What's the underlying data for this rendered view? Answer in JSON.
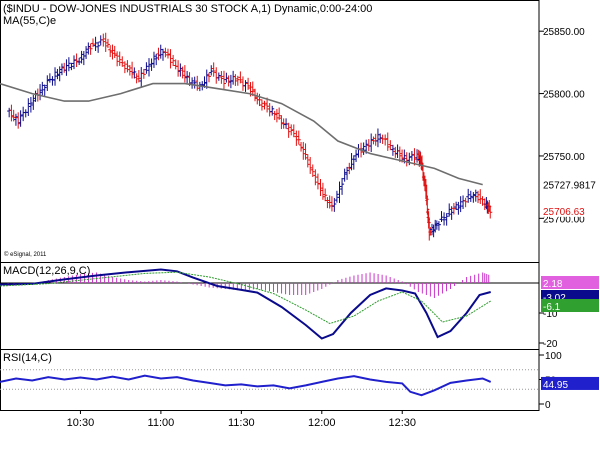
{
  "chart_data": [
    {
      "type": "candlestick",
      "title": "($INDU - DOW-JONES INDUSTRIALS 30 STOCK A,1) Dynamic,0:00-24:00",
      "overlay_label": "MA(55,C)e",
      "watermark": "© eSignal, 2011",
      "ylim": [
        25665,
        25875
      ],
      "y_ticks": [
        "25850.00",
        "25800.00",
        "25750.00",
        "25700.00"
      ],
      "x_ticks": [
        "10:30",
        "11:00",
        "11:30",
        "12:00",
        "12:30"
      ],
      "ma_value_label": "25727.9817",
      "price_value_label": "25706.63",
      "close_points": [
        [
          10.05,
          25786
        ],
        [
          10.12,
          25778
        ],
        [
          10.2,
          25793
        ],
        [
          10.27,
          25805
        ],
        [
          10.35,
          25815
        ],
        [
          10.42,
          25822
        ],
        [
          10.5,
          25827
        ],
        [
          10.57,
          25838
        ],
        [
          10.65,
          25842
        ],
        [
          10.72,
          25830
        ],
        [
          10.8,
          25820
        ],
        [
          10.87,
          25812
        ],
        [
          10.95,
          25826
        ],
        [
          11.02,
          25835
        ],
        [
          11.1,
          25822
        ],
        [
          11.17,
          25812
        ],
        [
          11.25,
          25805
        ],
        [
          11.32,
          25818
        ],
        [
          11.4,
          25810
        ],
        [
          11.47,
          25812
        ],
        [
          11.55,
          25806
        ],
        [
          11.62,
          25793
        ],
        [
          11.7,
          25786
        ],
        [
          11.77,
          25776
        ],
        [
          11.85,
          25765
        ],
        [
          11.92,
          25745
        ],
        [
          12.0,
          25722
        ],
        [
          12.07,
          25708
        ],
        [
          12.15,
          25735
        ],
        [
          12.22,
          25752
        ],
        [
          12.3,
          25760
        ],
        [
          12.37,
          25766
        ],
        [
          12.45,
          25755
        ],
        [
          12.52,
          25748
        ],
        [
          12.6,
          25750
        ],
        [
          12.62,
          25745
        ],
        [
          12.65,
          25720
        ],
        [
          12.67,
          25688
        ],
        [
          12.72,
          25695
        ],
        [
          12.8,
          25705
        ],
        [
          12.87,
          25712
        ],
        [
          12.95,
          25720
        ],
        [
          13.02,
          25712
        ],
        [
          13.05,
          25706
        ]
      ],
      "ma_points": [
        [
          10.0,
          25808
        ],
        [
          10.2,
          25800
        ],
        [
          10.4,
          25794
        ],
        [
          10.55,
          25794
        ],
        [
          10.75,
          25800
        ],
        [
          10.95,
          25808
        ],
        [
          11.15,
          25808
        ],
        [
          11.35,
          25804
        ],
        [
          11.55,
          25800
        ],
        [
          11.75,
          25792
        ],
        [
          11.95,
          25778
        ],
        [
          12.1,
          25762
        ],
        [
          12.3,
          25752
        ],
        [
          12.5,
          25746
        ],
        [
          12.7,
          25740
        ],
        [
          12.85,
          25732
        ],
        [
          13.0,
          25727
        ]
      ]
    },
    {
      "type": "line",
      "title": "MACD(12,26,9,C)",
      "ylim": [
        -22,
        7
      ],
      "y_ticks": [
        "-10",
        "-20"
      ],
      "value_labels": [
        "2.18",
        "-3.02",
        "-6.1"
      ],
      "series": [
        {
          "name": "MACD",
          "color": "#0a0a8c",
          "points": [
            [
              10.0,
              -0.5
            ],
            [
              10.2,
              -0.3
            ],
            [
              10.4,
              1.2
            ],
            [
              10.6,
              2.5
            ],
            [
              10.8,
              3.6
            ],
            [
              11.0,
              4.5
            ],
            [
              11.1,
              3.9
            ],
            [
              11.2,
              1.8
            ],
            [
              11.35,
              -1
            ],
            [
              11.5,
              -2.3
            ],
            [
              11.6,
              -3.2
            ],
            [
              11.75,
              -8
            ],
            [
              11.9,
              -14
            ],
            [
              12.0,
              -18.5
            ],
            [
              12.07,
              -17
            ],
            [
              12.18,
              -10
            ],
            [
              12.3,
              -4
            ],
            [
              12.4,
              -1.8
            ],
            [
              12.5,
              -2.5
            ],
            [
              12.58,
              -3.5
            ],
            [
              12.65,
              -10
            ],
            [
              12.72,
              -18
            ],
            [
              12.8,
              -16
            ],
            [
              12.9,
              -10
            ],
            [
              12.98,
              -4
            ],
            [
              13.05,
              -3
            ]
          ]
        },
        {
          "name": "Signal",
          "color": "#2e9c2e",
          "points": [
            [
              10.0,
              -1
            ],
            [
              10.3,
              -0.2
            ],
            [
              10.6,
              1.5
            ],
            [
              10.9,
              3.2
            ],
            [
              11.1,
              3.6
            ],
            [
              11.3,
              2
            ],
            [
              11.5,
              -0.5
            ],
            [
              11.7,
              -3.5
            ],
            [
              11.9,
              -9
            ],
            [
              12.05,
              -13.5
            ],
            [
              12.2,
              -11
            ],
            [
              12.35,
              -6
            ],
            [
              12.5,
              -3
            ],
            [
              12.62,
              -6
            ],
            [
              12.75,
              -13
            ],
            [
              12.9,
              -11
            ],
            [
              13.05,
              -6
            ]
          ]
        }
      ],
      "histogram": {
        "color": "#cc33cc",
        "points": [
          [
            10.05,
            -1
          ],
          [
            10.2,
            -0.5
          ],
          [
            10.3,
            1
          ],
          [
            10.4,
            2
          ],
          [
            10.5,
            3
          ],
          [
            10.6,
            3.5
          ],
          [
            10.7,
            2
          ],
          [
            10.8,
            1
          ],
          [
            10.9,
            0.5
          ],
          [
            11.0,
            1
          ],
          [
            11.1,
            0.5
          ],
          [
            11.2,
            -0.5
          ],
          [
            11.3,
            -1.5
          ],
          [
            11.4,
            -2
          ],
          [
            11.5,
            -2.5
          ],
          [
            11.6,
            -2
          ],
          [
            11.7,
            -3
          ],
          [
            11.8,
            -4
          ],
          [
            11.9,
            -4
          ],
          [
            12.0,
            -2
          ],
          [
            12.1,
            1
          ],
          [
            12.2,
            2.5
          ],
          [
            12.3,
            3.5
          ],
          [
            12.4,
            2.5
          ],
          [
            12.5,
            0.5
          ],
          [
            12.6,
            -3
          ],
          [
            12.7,
            -5
          ],
          [
            12.8,
            -2
          ],
          [
            12.9,
            2
          ],
          [
            13.0,
            3.5
          ],
          [
            13.05,
            2.5
          ]
        ]
      }
    },
    {
      "type": "line",
      "title": "RSI(14,C)",
      "ylim": [
        0,
        100
      ],
      "y_ticks": [
        "100",
        "50",
        "0"
      ],
      "value_label": "44.95",
      "series": [
        {
          "name": "RSI",
          "color": "#2020cc",
          "points": [
            [
              10.0,
              45
            ],
            [
              10.1,
              52
            ],
            [
              10.2,
              48
            ],
            [
              10.3,
              55
            ],
            [
              10.4,
              50
            ],
            [
              10.5,
              54
            ],
            [
              10.6,
              50
            ],
            [
              10.7,
              56
            ],
            [
              10.8,
              50
            ],
            [
              10.9,
              58
            ],
            [
              11.0,
              52
            ],
            [
              11.1,
              55
            ],
            [
              11.2,
              48
            ],
            [
              11.3,
              43
            ],
            [
              11.4,
              38
            ],
            [
              11.5,
              40
            ],
            [
              11.6,
              36
            ],
            [
              11.7,
              38
            ],
            [
              11.8,
              32
            ],
            [
              11.9,
              38
            ],
            [
              12.0,
              45
            ],
            [
              12.1,
              52
            ],
            [
              12.2,
              57
            ],
            [
              12.3,
              50
            ],
            [
              12.4,
              45
            ],
            [
              12.5,
              42
            ],
            [
              12.55,
              25
            ],
            [
              12.62,
              18
            ],
            [
              12.7,
              28
            ],
            [
              12.8,
              43
            ],
            [
              12.9,
              48
            ],
            [
              13.0,
              52
            ],
            [
              13.05,
              45
            ]
          ]
        }
      ]
    }
  ]
}
